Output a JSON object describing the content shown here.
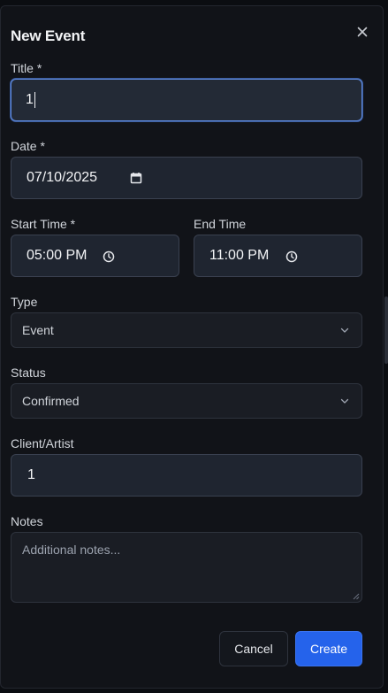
{
  "dialog": {
    "title": "New Event",
    "close_icon": "close-icon"
  },
  "form": {
    "title": {
      "label": "Title *",
      "value": "1"
    },
    "date": {
      "label": "Date *",
      "value": "07/10/2025",
      "icon": "calendar-icon"
    },
    "start_time": {
      "label": "Start Time *",
      "value": "05:00 PM",
      "icon": "clock-icon"
    },
    "end_time": {
      "label": "End Time",
      "value": "11:00 PM",
      "icon": "clock-icon"
    },
    "type": {
      "label": "Type",
      "value": "Event",
      "icon": "chevron-down-icon"
    },
    "status": {
      "label": "Status",
      "value": "Confirmed",
      "icon": "chevron-down-icon"
    },
    "client": {
      "label": "Client/Artist",
      "value": "1"
    },
    "notes": {
      "label": "Notes",
      "placeholder": "Additional notes..."
    }
  },
  "actions": {
    "cancel_label": "Cancel",
    "create_label": "Create"
  },
  "colors": {
    "background": "#111318",
    "field": "#1f2530",
    "focus_border": "#5f8be0",
    "primary": "#2563eb"
  }
}
